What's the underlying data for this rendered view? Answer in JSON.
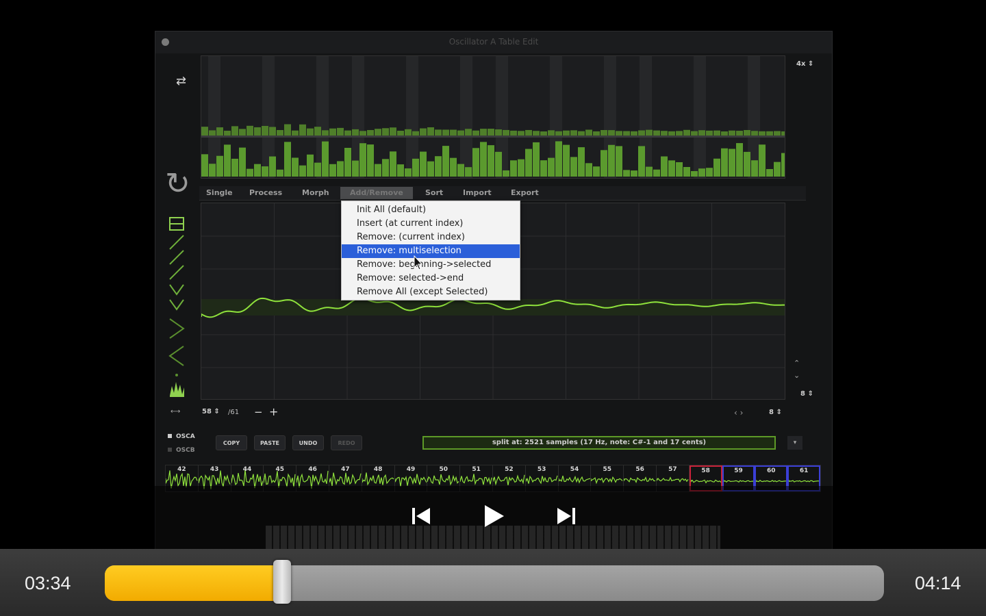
{
  "window": {
    "title": "Oscillator A Table Edit"
  },
  "colors": {
    "accent": "#8fd14f",
    "selection": "#2b5fd9",
    "progress": "#f5b400"
  },
  "toolbar": {
    "zoom": "4x",
    "right_readout": "8",
    "lr_readout": "8"
  },
  "tabs": [
    "Single",
    "Process",
    "Morph",
    "Add/Remove",
    "Sort",
    "Import",
    "Export"
  ],
  "context_menu": {
    "items": [
      "Init All (default)",
      "Insert (at current index)",
      "Remove: (current index)",
      "Remove: multiselection",
      "Remove: beginning->selected",
      "Remove: selected->end",
      "Remove All (except Selected)"
    ],
    "selected_index": 3
  },
  "nav": {
    "index": "58",
    "count": "/61",
    "minus": "−",
    "plus": "+"
  },
  "osc": {
    "a": "OSCA",
    "b": "OSCB"
  },
  "buttons": {
    "copy": "COPY",
    "paste": "PASTE",
    "undo": "UNDO",
    "redo": "REDO"
  },
  "status": "split at: 2521 samples (17 Hz, note: C#-1 and 17 cents)",
  "thumbnails": {
    "numbers": [
      "42",
      "43",
      "44",
      "45",
      "46",
      "47",
      "48",
      "49",
      "50",
      "51",
      "52",
      "53",
      "54",
      "55",
      "56",
      "57",
      "58",
      "59",
      "60",
      "61"
    ],
    "selected": "58",
    "highlighted": [
      "59",
      "60",
      "61"
    ]
  },
  "player": {
    "current_time": "03:34",
    "total_time": "04:14",
    "progress": 0.225
  }
}
